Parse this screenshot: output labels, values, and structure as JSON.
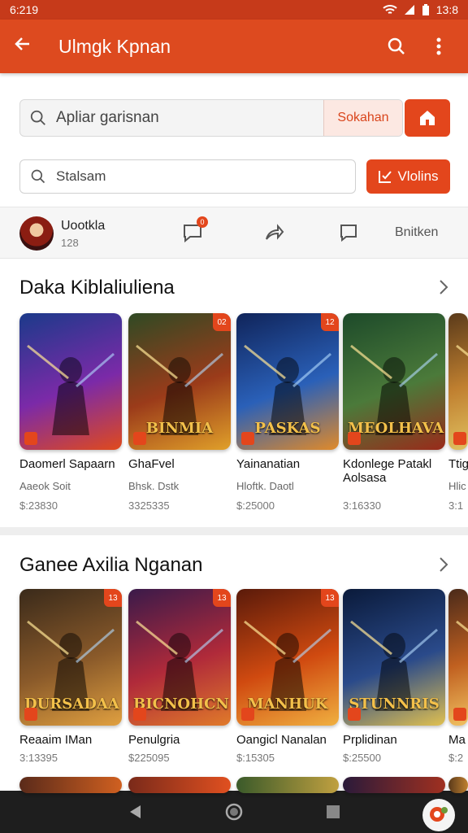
{
  "status": {
    "time": "6:219",
    "clock": "13:8"
  },
  "app_bar": {
    "title": "Ulmgk Kpnan"
  },
  "search1": {
    "placeholder": "Apliar garisnan",
    "tag": "Sokahan"
  },
  "search2": {
    "placeholder": "Stalsam",
    "button": "Vlolins"
  },
  "user": {
    "name": "Uootkla",
    "count": "128",
    "badge": "0",
    "action_text": "Bnitken"
  },
  "section1": {
    "title": "Daka Kiblaliuliena",
    "cards": [
      {
        "name": "Daomerl Sapaarn",
        "sub": "Aaeok Soit",
        "price": "$:23830",
        "corner": "",
        "art": "",
        "colors": [
          "#1b3a8a",
          "#7b2aa8",
          "#e04a1c"
        ]
      },
      {
        "name": "GhaFvel",
        "sub": "Bhsk. Dstk",
        "price": "3325335",
        "corner": "02",
        "art": "BINMIA",
        "colors": [
          "#2f4a24",
          "#9b3b1a",
          "#e0a02a"
        ]
      },
      {
        "name": "Yainanatian",
        "sub": "Hloftk. Daotl",
        "price": "$:25000",
        "corner": "12",
        "art": "PASKAS",
        "colors": [
          "#10245a",
          "#2a60b8",
          "#e08a2a"
        ]
      },
      {
        "name": "Kdonlege Patakl Aolsasa",
        "sub": "",
        "price": "3:16330",
        "corner": "",
        "art": "MEOLHAVA",
        "colors": [
          "#1d4a2a",
          "#4b7a3a",
          "#9a2a1a"
        ]
      },
      {
        "name": "Ttig",
        "sub": "Hlic",
        "price": "3:1",
        "corner": "",
        "art": "T",
        "colors": [
          "#5a3a1a",
          "#c08030",
          "#e0c060"
        ]
      }
    ]
  },
  "section2": {
    "title": "Ganee Axilia Nganan",
    "cards": [
      {
        "name": "Reaaim IMan",
        "sub": "",
        "price": "3:13395",
        "corner": "13",
        "art": "DURSADAA",
        "colors": [
          "#3a2a1a",
          "#8a5a2a",
          "#e0a040"
        ]
      },
      {
        "name": "Penulgria",
        "sub": "",
        "price": "$225095",
        "corner": "13",
        "art": "BICNOHCN",
        "colors": [
          "#3a1a4a",
          "#b02a3a",
          "#e07a2a"
        ]
      },
      {
        "name": "Oangicl Nanalan",
        "sub": "",
        "price": "$:15305",
        "corner": "13",
        "art": "MANHUK",
        "colors": [
          "#5a1a0a",
          "#d04a10",
          "#f0b040"
        ]
      },
      {
        "name": "Prplidinan",
        "sub": "",
        "price": "$:25500",
        "corner": "",
        "art": "STUNNRIS",
        "colors": [
          "#0a1a3a",
          "#2a4a8a",
          "#e0c050"
        ]
      },
      {
        "name": "Ma",
        "sub": "",
        "price": "$:2",
        "corner": "",
        "art": "",
        "colors": [
          "#4a2a1a",
          "#c06020",
          "#f0c060"
        ]
      }
    ]
  },
  "nav": {
    "back": "back-nav",
    "home": "home-nav",
    "recent": "recent-nav"
  }
}
